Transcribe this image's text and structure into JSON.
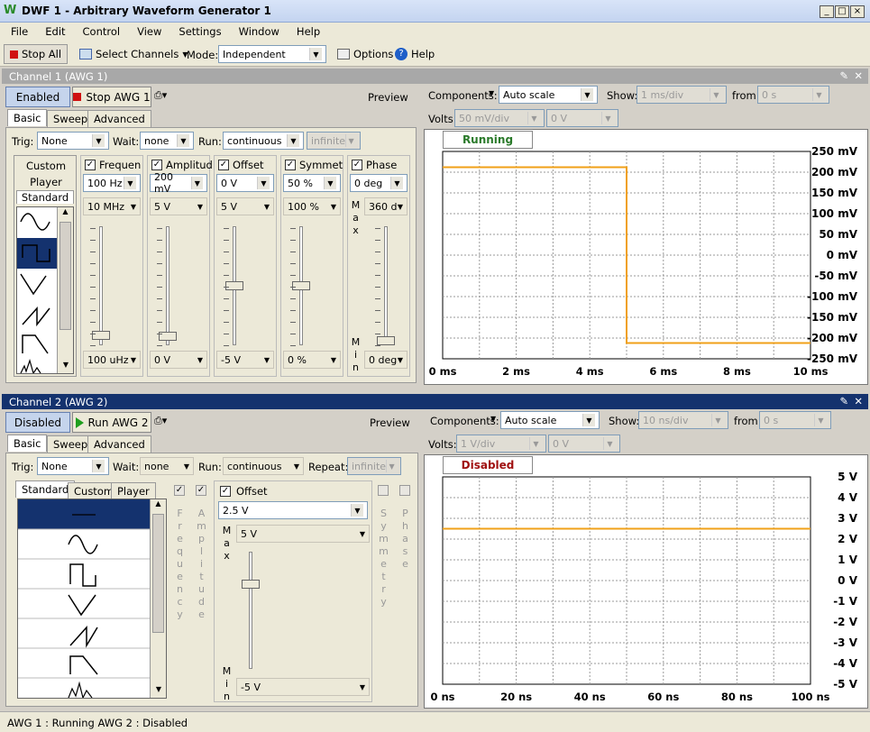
{
  "window": {
    "title": "DWF 1 - Arbitrary Waveform Generator 1"
  },
  "menu": [
    "File",
    "Edit",
    "Control",
    "View",
    "Settings",
    "Window",
    "Help"
  ],
  "toolbar": {
    "stop_all": "Stop All",
    "select_channels": "Select Channels",
    "mode_label": "Mode:",
    "mode_value": "Independent",
    "options": "Options",
    "help": "Help"
  },
  "ch1": {
    "header": "Channel 1 (AWG 1)",
    "enabled": "Enabled",
    "stop": "Stop AWG 1",
    "preview": "Preview",
    "tabs": [
      "Basic",
      "Sweep",
      "Advanced"
    ],
    "trig_label": "Trig:",
    "trig": "None",
    "wait_label": "Wait:",
    "wait": "none",
    "run_label": "Run:",
    "run": "continuous",
    "repeat": "infinite",
    "wave_tabs": [
      "Custom",
      "Player",
      "Standard"
    ],
    "params": [
      {
        "name": "Frequen",
        "value": "100 Hz",
        "max": "10 MHz",
        "min": "100 uHz",
        "level": 0.05
      },
      {
        "name": "Amplitud",
        "value": "200 mV",
        "max": "5 V",
        "min": "0 V",
        "level": 0.04
      },
      {
        "name": "Offset",
        "value": "0 V",
        "max": "5 V",
        "min": "-5 V",
        "level": 0.5
      },
      {
        "name": "Symmet",
        "value": "50 %",
        "max": "100 %",
        "min": "0 %",
        "level": 0.5
      },
      {
        "name": "Phase",
        "value": "0 deg",
        "max": "360 d",
        "min": "0 deg",
        "level": 0.0
      }
    ],
    "max_word": "Max",
    "min_word": "Min",
    "plot": {
      "components_label": "Components:",
      "components": "Auto scale",
      "show_label": "Show:",
      "show": "1 ms/div",
      "from_label": "from:",
      "from": "0 s",
      "volts_label": "Volts:",
      "volts": "50 mV/div",
      "volts_offset": "0 V",
      "state": "Running",
      "y_ticks": [
        "250 mV",
        "200 mV",
        "150 mV",
        "100 mV",
        "50 mV",
        "0 mV",
        "-50 mV",
        "-100 mV",
        "-150 mV",
        "-200 mV",
        "-250 mV"
      ],
      "x_ticks": [
        "0 ms",
        "2 ms",
        "4 ms",
        "6 ms",
        "8 ms",
        "10 ms"
      ]
    }
  },
  "ch2": {
    "header": "Channel 2 (AWG 2)",
    "enabled": "Disabled",
    "run": "Run AWG 2",
    "preview": "Preview",
    "tabs": [
      "Basic",
      "Sweep",
      "Advanced"
    ],
    "trig_label": "Trig:",
    "trig": "None",
    "wait_label": "Wait:",
    "wait": "none",
    "run_label": "Run:",
    "run_mode": "continuous",
    "repeat_label": "Repeat:",
    "repeat": "infinite",
    "wave_tabs": [
      "Standard",
      "Custom",
      "Player"
    ],
    "frequency": "Frequency",
    "amplitude": "Amplitude",
    "offset_label": "Offset",
    "offset": "2.5 V",
    "offset_max": "5 V",
    "offset_min": "-5 V",
    "offset_level": 0.75,
    "symmetry": "Symmetry",
    "phase": "Phase",
    "max_word": "Max",
    "min_word": "Min",
    "plot": {
      "components_label": "Components:",
      "components": "Auto scale",
      "show_label": "Show:",
      "show": "10 ns/div",
      "from_label": "from:",
      "from": "0 s",
      "volts_label": "Volts:",
      "volts": "1 V/div",
      "volts_offset": "0 V",
      "state": "Disabled",
      "y_ticks": [
        "5 V",
        "4 V",
        "3 V",
        "2 V",
        "1 V",
        "0 V",
        "-1 V",
        "-2 V",
        "-3 V",
        "-4 V",
        "-5 V"
      ],
      "x_ticks": [
        "0 ns",
        "20 ns",
        "40 ns",
        "60 ns",
        "80 ns",
        "100 ns"
      ]
    }
  },
  "status": "AWG 1 : Running  AWG 2 : Disabled",
  "colors": {
    "trace": "#f0a018",
    "running": "#2a7a2a",
    "disabled": "#a01010",
    "header_active": "#14326e"
  }
}
